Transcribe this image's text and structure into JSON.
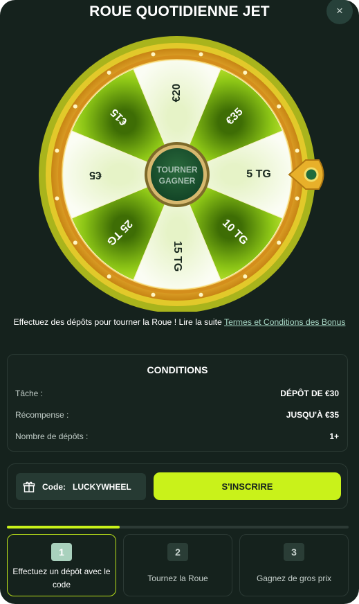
{
  "header": {
    "title": "ROUE QUOTIDIENNE JET",
    "close_label": "×"
  },
  "wheel": {
    "center_line1": "TOURNER",
    "center_line2": "GAGNER",
    "segments": [
      "€20",
      "€35",
      "5 TG",
      "10 TG",
      "15 TG",
      "25 TG",
      "€5",
      "€15"
    ]
  },
  "description": {
    "text": "Effectuez des dépôts pour tourner la Roue ! Lire la suite ",
    "link": "Termes et Conditions des Bonus"
  },
  "conditions": {
    "title": "CONDITIONS",
    "rows": [
      {
        "label": "Tâche :",
        "value": "DÉPÔT DE €30"
      },
      {
        "label": "Récompense :",
        "value": "JUSQU'À €35"
      },
      {
        "label": "Nombre de dépôts :",
        "value": "1+"
      }
    ]
  },
  "code": {
    "label": "Code:",
    "value": "LUCKYWHEEL",
    "button": "S'INSCRIRE"
  },
  "progress": {
    "fraction": 0.33
  },
  "steps": [
    {
      "number": "1",
      "text": "Effectuez un dépôt avec le code"
    },
    {
      "number": "2",
      "text": "Tournez la Roue"
    },
    {
      "number": "3",
      "text": "Gagnez de gros prix"
    }
  ],
  "colors": {
    "background": "#15221d",
    "accent": "#c9f21a",
    "wheel_rim": "#e8a825",
    "segment_dark": "#7dba0d",
    "segment_light": "#f1fae0"
  }
}
